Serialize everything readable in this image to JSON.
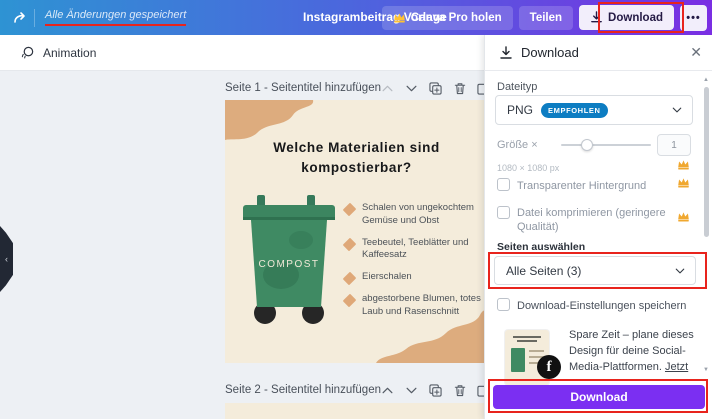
{
  "topbar": {
    "saved_status": "Alle Änderungen gespeichert",
    "design_title": "Instagrambeitrag Vorlage",
    "pro_button": "Canva Pro holen",
    "share_button": "Teilen",
    "download_button": "Download",
    "more_label": "•••"
  },
  "toolbar": {
    "animation_label": "Animation"
  },
  "canvas": {
    "page1": {
      "header": "Seite 1 - Seitentitel hinzufügen",
      "title_line1": "Welche Materialien sind",
      "title_line2": "kompostierbar?",
      "bin_label": "COMPOST",
      "bullets": [
        "Schalen von ungekochtem Gemüse und Obst",
        "Teebeutel, Teeblätter und Kaffeesatz",
        "Eierschalen",
        "abgestorbene Blumen, totes Laub und Rasenschnitt"
      ]
    },
    "page2": {
      "header": "Seite 2 - Seitentitel hinzufügen"
    }
  },
  "panel": {
    "title": "Download",
    "filetype_label": "Dateityp",
    "filetype_value": "PNG",
    "filetype_badge": "EMPFOHLEN",
    "size_label": "Größe ×",
    "size_value": "1",
    "dimensions": "1080 × 1080 px",
    "transparent_label": "Transparenter Hintergrund",
    "compress_label": "Datei komprimieren (geringere Qualität)",
    "pages_label": "Seiten auswählen",
    "pages_value": "Alle Seiten (3)",
    "save_settings_label": "Download-Einstellungen speichern",
    "promo_text": "Spare Zeit – plane dieses Design für deine Social-Media-Plattformen. ",
    "promo_link": "Jetzt",
    "download_cta": "Download"
  },
  "colors": {
    "accent_purple": "#7b2ff2",
    "badge_blue": "#0d7dc2",
    "crown_gold": "#f0a830",
    "annotation_red": "#e8241d",
    "page_cream": "#f4ecdb",
    "bin_green": "#3f8a63",
    "blob_tan": "#ddac7e"
  }
}
